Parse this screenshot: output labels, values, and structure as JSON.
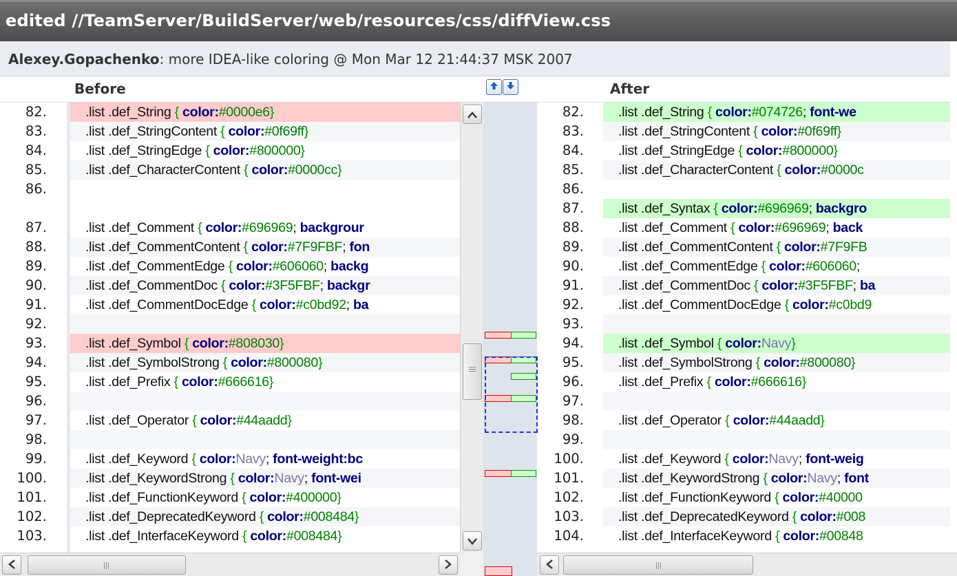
{
  "title": "edited //TeamServer/BuildServer/web/resources/css/diffView.css",
  "commit": {
    "author": "Alexey.Gopachenko",
    "message": ": more IDEA-like coloring @ Mon Mar 12 21:44:37 MSK 2007"
  },
  "headers": {
    "before": "Before",
    "after": "After"
  },
  "icons": {
    "prev_change": "arrow-up-icon",
    "next_change": "arrow-down-icon",
    "scroll_up": "triangle-up-icon",
    "scroll_down": "triangle-down-icon",
    "scroll_left": "triangle-left-icon",
    "scroll_right": "triangle-right-icon"
  },
  "colors": {
    "deleted_bg": "#ffcccc",
    "added_bg": "#ccffcc",
    "keyword": "#000080",
    "value": "#008000",
    "title_bar": "#5a5a5a"
  },
  "before": [
    {
      "num": "82.",
      "type": "del",
      "sel": ".list .def_String",
      "body": [
        [
          "k",
          "color:"
        ],
        [
          "v",
          "#0000e6"
        ]
      ],
      "close": true
    },
    {
      "num": "83.",
      "type": "alt",
      "sel": ".list .def_StringContent",
      "body": [
        [
          "k",
          "color:"
        ],
        [
          "v",
          "#0f69ff"
        ]
      ],
      "close": true
    },
    {
      "num": "84.",
      "type": "normal",
      "sel": ".list .def_StringEdge",
      "body": [
        [
          "k",
          "color:"
        ],
        [
          "v",
          "#800000"
        ]
      ],
      "close": true
    },
    {
      "num": "85.",
      "type": "alt",
      "sel": ".list .def_CharacterContent",
      "body": [
        [
          "k",
          "color:"
        ],
        [
          "v",
          "#0000cc"
        ]
      ],
      "close": true
    },
    {
      "num": "86.",
      "type": "normal",
      "sel": "",
      "body": [],
      "close": false
    },
    {
      "num": "",
      "type": "blank",
      "sel": "",
      "body": [],
      "close": false
    },
    {
      "num": "87.",
      "type": "normal",
      "sel": ".list .def_Comment",
      "body": [
        [
          "k",
          "color:"
        ],
        [
          "v",
          "#696969"
        ],
        [
          "t",
          "; "
        ],
        [
          "k",
          "backgrour"
        ]
      ],
      "close": false
    },
    {
      "num": "88.",
      "type": "alt",
      "sel": ".list .def_CommentContent",
      "body": [
        [
          "k",
          "color:"
        ],
        [
          "v",
          "#7F9FBF"
        ],
        [
          "t",
          "; "
        ],
        [
          "k",
          "fon"
        ]
      ],
      "close": false
    },
    {
      "num": "89.",
      "type": "normal",
      "sel": ".list .def_CommentEdge",
      "body": [
        [
          "k",
          "color:"
        ],
        [
          "v",
          "#606060"
        ],
        [
          "t",
          "; "
        ],
        [
          "k",
          "backg"
        ]
      ],
      "close": false
    },
    {
      "num": "90.",
      "type": "alt",
      "sel": ".list .def_CommentDoc",
      "body": [
        [
          "k",
          "color:"
        ],
        [
          "v",
          "#3F5FBF"
        ],
        [
          "t",
          "; "
        ],
        [
          "k",
          "backgr"
        ]
      ],
      "close": false
    },
    {
      "num": "91.",
      "type": "normal",
      "sel": ".list .def_CommentDocEdge",
      "body": [
        [
          "k",
          "color:"
        ],
        [
          "v",
          "#c0bd92"
        ],
        [
          "t",
          "; "
        ],
        [
          "k",
          "ba"
        ]
      ],
      "close": false
    },
    {
      "num": "92.",
      "type": "alt",
      "sel": "",
      "body": [],
      "close": false
    },
    {
      "num": "93.",
      "type": "del",
      "sel": ".list .def_Symbol",
      "body": [
        [
          "k",
          "color:"
        ],
        [
          "v",
          "#808030"
        ]
      ],
      "close": true
    },
    {
      "num": "94.",
      "type": "alt",
      "sel": ".list .def_SymbolStrong",
      "body": [
        [
          "k",
          "color:"
        ],
        [
          "v",
          "#800080"
        ]
      ],
      "close": true
    },
    {
      "num": "95.",
      "type": "normal",
      "sel": ".list .def_Prefix",
      "body": [
        [
          "k",
          "color:"
        ],
        [
          "v",
          "#666616"
        ]
      ],
      "close": true
    },
    {
      "num": "96.",
      "type": "alt",
      "sel": "",
      "body": [],
      "close": false
    },
    {
      "num": "97.",
      "type": "normal",
      "sel": ".list .def_Operator",
      "body": [
        [
          "k",
          "color:"
        ],
        [
          "v",
          "#44aadd"
        ]
      ],
      "close": true
    },
    {
      "num": "98.",
      "type": "alt",
      "sel": "",
      "body": [],
      "close": false
    },
    {
      "num": "99.",
      "type": "normal",
      "sel": ".list .def_Keyword",
      "body": [
        [
          "k",
          "color:"
        ],
        [
          "n",
          "Navy"
        ],
        [
          "t",
          "; "
        ],
        [
          "k",
          "font-weight:"
        ],
        [
          "k",
          "bc"
        ]
      ],
      "close": false
    },
    {
      "num": "100.",
      "type": "alt",
      "sel": ".list .def_KeywordStrong",
      "body": [
        [
          "k",
          "color:"
        ],
        [
          "n",
          "Navy"
        ],
        [
          "t",
          "; "
        ],
        [
          "k",
          "font-wei"
        ]
      ],
      "close": false
    },
    {
      "num": "101.",
      "type": "normal",
      "sel": ".list .def_FunctionKeyword",
      "body": [
        [
          "k",
          "color:"
        ],
        [
          "v",
          "#400000"
        ]
      ],
      "close": true
    },
    {
      "num": "102.",
      "type": "alt",
      "sel": ".list .def_DeprecatedKeyword",
      "body": [
        [
          "k",
          "color:"
        ],
        [
          "v",
          "#008484"
        ]
      ],
      "close": true
    },
    {
      "num": "103.",
      "type": "normal",
      "sel": ".list .def_InterfaceKeyword",
      "body": [
        [
          "k",
          "color:"
        ],
        [
          "v",
          "#008484"
        ]
      ],
      "close": true
    }
  ],
  "after": [
    {
      "num": "82.",
      "type": "add",
      "sel": ".list .def_String",
      "body": [
        [
          "k",
          "color:"
        ],
        [
          "v",
          "#074726"
        ],
        [
          "t",
          "; "
        ],
        [
          "k",
          "font-we"
        ]
      ],
      "close": false
    },
    {
      "num": "83.",
      "type": "alt",
      "sel": ".list .def_StringContent",
      "body": [
        [
          "k",
          "color:"
        ],
        [
          "v",
          "#0f69ff"
        ]
      ],
      "close": true
    },
    {
      "num": "84.",
      "type": "normal",
      "sel": ".list .def_StringEdge",
      "body": [
        [
          "k",
          "color:"
        ],
        [
          "v",
          "#800000"
        ]
      ],
      "close": true
    },
    {
      "num": "85.",
      "type": "alt",
      "sel": ".list .def_CharacterContent",
      "body": [
        [
          "k",
          "color:"
        ],
        [
          "v",
          "#0000c"
        ]
      ],
      "close": false
    },
    {
      "num": "86.",
      "type": "normal",
      "sel": "",
      "body": [],
      "close": false
    },
    {
      "num": "87.",
      "type": "add",
      "sel": ".list .def_Syntax",
      "body": [
        [
          "k",
          "color:"
        ],
        [
          "v",
          "#696969"
        ],
        [
          "t",
          "; "
        ],
        [
          "k",
          "backgro"
        ]
      ],
      "close": false
    },
    {
      "num": "88.",
      "type": "normal",
      "sel": ".list .def_Comment",
      "body": [
        [
          "k",
          "color:"
        ],
        [
          "v",
          "#696969"
        ],
        [
          "t",
          "; "
        ],
        [
          "k",
          "back"
        ]
      ],
      "close": false
    },
    {
      "num": "89.",
      "type": "alt",
      "sel": ".list .def_CommentContent",
      "body": [
        [
          "k",
          "color:"
        ],
        [
          "v",
          "#7F9FB"
        ]
      ],
      "close": false
    },
    {
      "num": "90.",
      "type": "normal",
      "sel": ".list .def_CommentEdge",
      "body": [
        [
          "k",
          "color:"
        ],
        [
          "v",
          "#606060"
        ],
        [
          "t",
          "; "
        ]
      ],
      "close": false
    },
    {
      "num": "91.",
      "type": "alt",
      "sel": ".list .def_CommentDoc",
      "body": [
        [
          "k",
          "color:"
        ],
        [
          "v",
          "#3F5FBF"
        ],
        [
          "t",
          "; "
        ],
        [
          "k",
          "ba"
        ]
      ],
      "close": false
    },
    {
      "num": "92.",
      "type": "normal",
      "sel": ".list .def_CommentDocEdge",
      "body": [
        [
          "k",
          "color:"
        ],
        [
          "v",
          "#c0bd9"
        ]
      ],
      "close": false
    },
    {
      "num": "93.",
      "type": "alt",
      "sel": "",
      "body": [],
      "close": false
    },
    {
      "num": "94.",
      "type": "add",
      "sel": ".list .def_Symbol",
      "body": [
        [
          "k",
          "color:"
        ],
        [
          "n",
          "Navy"
        ]
      ],
      "close": true
    },
    {
      "num": "95.",
      "type": "alt",
      "sel": ".list .def_SymbolStrong",
      "body": [
        [
          "k",
          "color:"
        ],
        [
          "v",
          "#800080"
        ]
      ],
      "close": true
    },
    {
      "num": "96.",
      "type": "normal",
      "sel": ".list .def_Prefix",
      "body": [
        [
          "k",
          "color:"
        ],
        [
          "v",
          "#666616"
        ]
      ],
      "close": true
    },
    {
      "num": "97.",
      "type": "alt",
      "sel": "",
      "body": [],
      "close": false
    },
    {
      "num": "98.",
      "type": "normal",
      "sel": ".list .def_Operator",
      "body": [
        [
          "k",
          "color:"
        ],
        [
          "v",
          "#44aadd"
        ]
      ],
      "close": true
    },
    {
      "num": "99.",
      "type": "alt",
      "sel": "",
      "body": [],
      "close": false
    },
    {
      "num": "100.",
      "type": "normal",
      "sel": ".list .def_Keyword",
      "body": [
        [
          "k",
          "color:"
        ],
        [
          "n",
          "Navy"
        ],
        [
          "t",
          "; "
        ],
        [
          "k",
          "font-weig"
        ]
      ],
      "close": false
    },
    {
      "num": "101.",
      "type": "alt",
      "sel": ".list .def_KeywordStrong",
      "body": [
        [
          "k",
          "color:"
        ],
        [
          "n",
          "Navy"
        ],
        [
          "t",
          "; "
        ],
        [
          "k",
          "font"
        ]
      ],
      "close": false
    },
    {
      "num": "102.",
      "type": "normal",
      "sel": ".list .def_FunctionKeyword",
      "body": [
        [
          "k",
          "color:"
        ],
        [
          "v",
          "#40000"
        ]
      ],
      "close": false
    },
    {
      "num": "103.",
      "type": "alt",
      "sel": ".list .def_DeprecatedKeyword",
      "body": [
        [
          "k",
          "color:"
        ],
        [
          "v",
          "#008"
        ]
      ],
      "close": false
    },
    {
      "num": "104.",
      "type": "normal",
      "sel": ".list .def_InterfaceKeyword",
      "body": [
        [
          "k",
          "color:"
        ],
        [
          "v",
          "#00848"
        ]
      ],
      "close": false
    }
  ]
}
